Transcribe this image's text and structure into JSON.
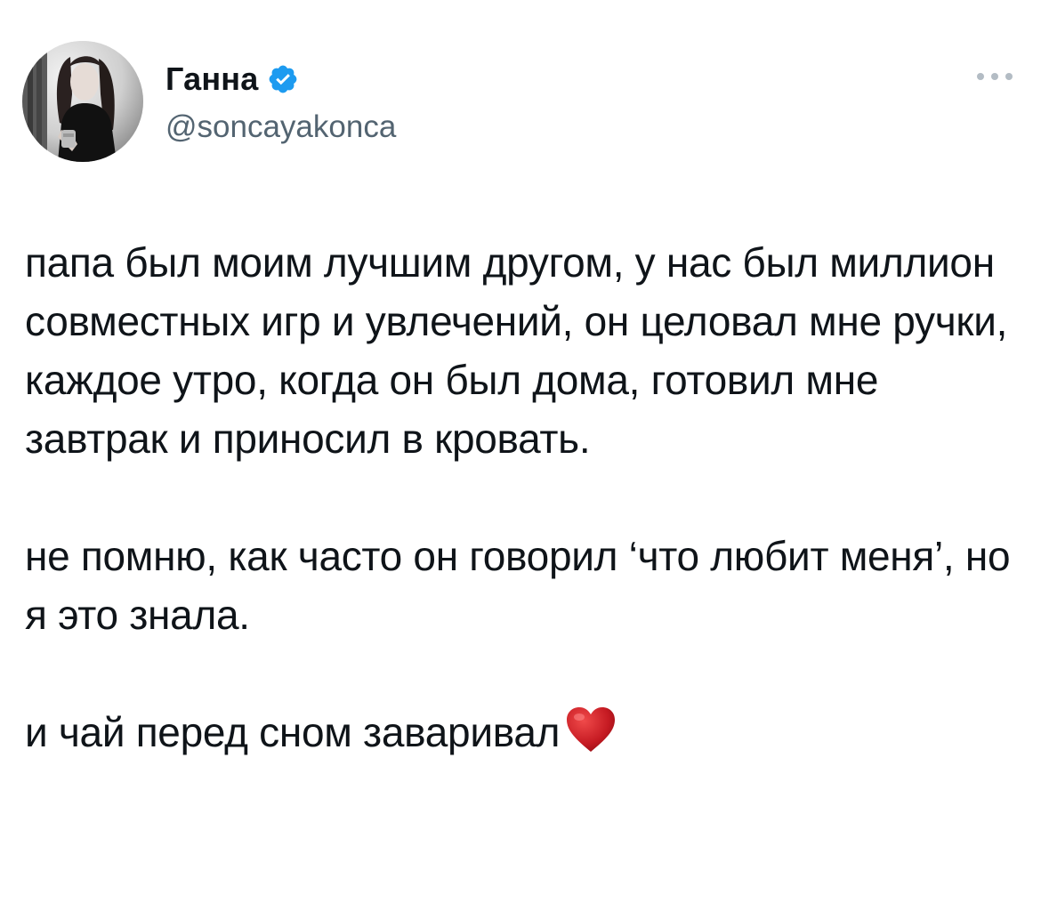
{
  "tweet": {
    "author": {
      "display_name": "Ганна",
      "handle": "@soncayakonca",
      "verified": true,
      "verified_color": "#1d9bf0"
    },
    "body": {
      "paragraph_1": "папа был моим лучшим другом, у нас был миллион совместных игр и увлечений, он целовал мне ручки, каждое утро, когда он был дома, готовил мне завтрак и приносил в кровать.",
      "paragraph_2": "не помню, как часто он говорил ‘что любит меня’, но я это знала.",
      "paragraph_3": "и чай перед сном заваривал",
      "paragraph_3_emoji": "red-heart-icon"
    },
    "more_icon": "ellipsis-icon"
  }
}
